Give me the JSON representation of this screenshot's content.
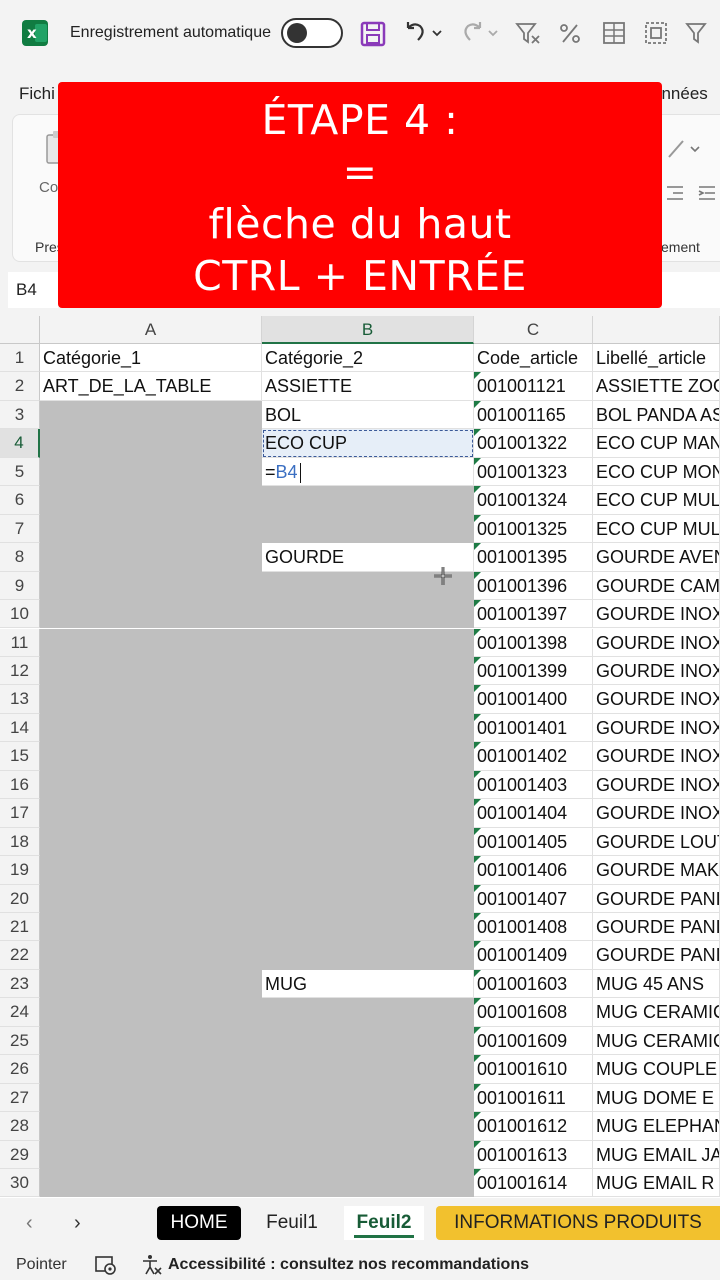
{
  "app": {
    "autosave_label": "Enregistrement automatique"
  },
  "ribbon": {
    "file_tab": "Fichi",
    "data_tab": "onnées",
    "paste_label": "Pres",
    "co_label": "Co",
    "alignment_label": "ement"
  },
  "banner": {
    "line1": "ÉTAPE 4 :",
    "line2": "=",
    "line3": "flèche du haut",
    "line4": "CTRL + ENTRÉE",
    "color": "#ff0000"
  },
  "namebox": {
    "value": "B4"
  },
  "columns": [
    "A",
    "B",
    "C",
    ""
  ],
  "rows": [
    {
      "n": "1",
      "a": "Catégorie_1",
      "b": "Catégorie_2",
      "c": "Code_article",
      "d": "Libellé_article"
    },
    {
      "n": "2",
      "a": "ART_DE_LA_TABLE",
      "b": "ASSIETTE",
      "c": "001001121",
      "d": "ASSIETTE ZOO"
    },
    {
      "n": "3",
      "a": "",
      "b": "BOL",
      "c": "001001165",
      "d": "BOL PANDA AS"
    },
    {
      "n": "4",
      "a": "",
      "b": "ECO CUP",
      "c": "001001322",
      "d": "ECO CUP MAN"
    },
    {
      "n": "5",
      "a": "",
      "b": "",
      "c": "001001323",
      "d": "ECO CUP MON"
    },
    {
      "n": "6",
      "a": "",
      "b": "",
      "c": "001001324",
      "d": "ECO CUP MUL"
    },
    {
      "n": "7",
      "a": "",
      "b": "",
      "c": "001001325",
      "d": "ECO CUP MUL"
    },
    {
      "n": "8",
      "a": "",
      "b": "GOURDE",
      "c": "001001395",
      "d": "GOURDE AVEN"
    },
    {
      "n": "9",
      "a": "",
      "b": "",
      "c": "001001396",
      "d": "GOURDE CAM"
    },
    {
      "n": "10",
      "a": "",
      "b": "",
      "c": "001001397",
      "d": "GOURDE INOX"
    },
    {
      "n": "11",
      "a": "",
      "b": "",
      "c": "001001398",
      "d": "GOURDE INOX"
    },
    {
      "n": "12",
      "a": "",
      "b": "",
      "c": "001001399",
      "d": "GOURDE INOX"
    },
    {
      "n": "13",
      "a": "",
      "b": "",
      "c": "001001400",
      "d": "GOURDE INOX"
    },
    {
      "n": "14",
      "a": "",
      "b": "",
      "c": "001001401",
      "d": "GOURDE INOX"
    },
    {
      "n": "15",
      "a": "",
      "b": "",
      "c": "001001402",
      "d": "GOURDE INOX"
    },
    {
      "n": "16",
      "a": "",
      "b": "",
      "c": "001001403",
      "d": "GOURDE INOX"
    },
    {
      "n": "17",
      "a": "",
      "b": "",
      "c": "001001404",
      "d": "GOURDE INOX"
    },
    {
      "n": "18",
      "a": "",
      "b": "",
      "c": "001001405",
      "d": "GOURDE LOUT"
    },
    {
      "n": "19",
      "a": "",
      "b": "",
      "c": "001001406",
      "d": "GOURDE MAK"
    },
    {
      "n": "20",
      "a": "",
      "b": "",
      "c": "001001407",
      "d": "GOURDE PANI"
    },
    {
      "n": "21",
      "a": "",
      "b": "",
      "c": "001001408",
      "d": "GOURDE PANI"
    },
    {
      "n": "22",
      "a": "",
      "b": "",
      "c": "001001409",
      "d": "GOURDE PANI"
    },
    {
      "n": "23",
      "a": "",
      "b": "MUG",
      "c": "001001603",
      "d": "MUG 45 ANS"
    },
    {
      "n": "24",
      "a": "",
      "b": "",
      "c": "001001608",
      "d": "MUG CERAMIC"
    },
    {
      "n": "25",
      "a": "",
      "b": "",
      "c": "001001609",
      "d": "MUG CERAMIC"
    },
    {
      "n": "26",
      "a": "",
      "b": "",
      "c": "001001610",
      "d": "MUG COUPLE"
    },
    {
      "n": "27",
      "a": "",
      "b": "",
      "c": "001001611",
      "d": "MUG DOME E"
    },
    {
      "n": "28",
      "a": "",
      "b": "",
      "c": "001001612",
      "d": "MUG ELEPHAN"
    },
    {
      "n": "29",
      "a": "",
      "b": "",
      "c": "001001613",
      "d": "MUG EMAIL JA"
    },
    {
      "n": "30",
      "a": "",
      "b": "",
      "c": "001001614",
      "d": "MUG EMAIL R"
    }
  ],
  "editing_cell": {
    "prefix": "=",
    "ref": "B4"
  },
  "sheets": {
    "home": "HOME",
    "feuil1": "Feuil1",
    "feuil2": "Feuil2",
    "info": "INFORMATIONS PRODUITS"
  },
  "status": {
    "mode": "Pointer",
    "accessibility": "Accessibilité : consultez nos recommandations"
  },
  "colors": {
    "excel_green": "#217346",
    "empty_fill": "#bfbfbf",
    "info_tab": "#f2c12e"
  }
}
